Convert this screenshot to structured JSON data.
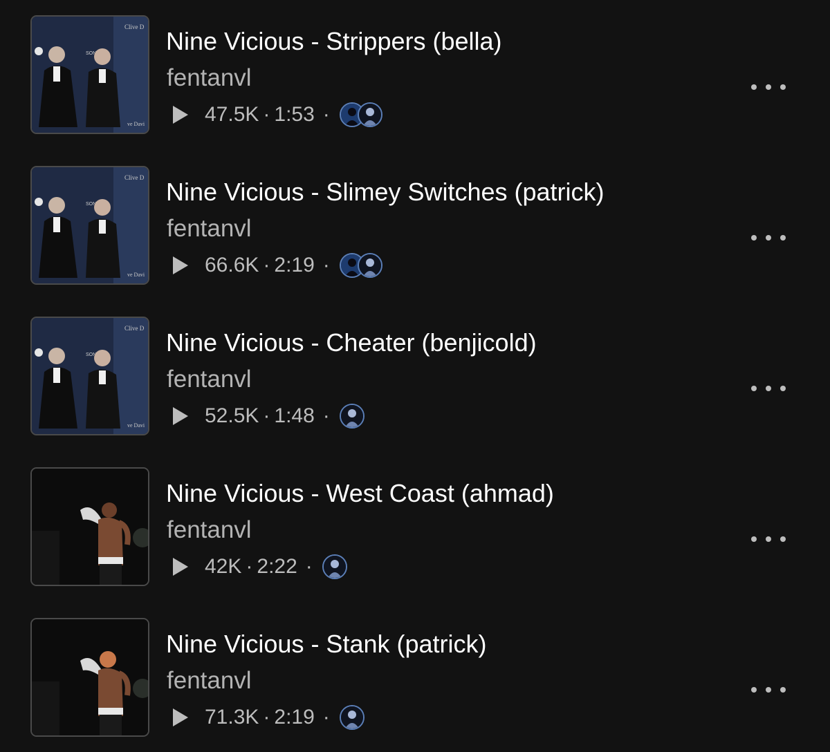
{
  "tracks": [
    {
      "title": "Nine Vicious - Strippers (bella)",
      "artist": "fentanvl",
      "plays": "47.5K",
      "duration": "1:53",
      "separator": "·",
      "artwork": "suits-photo",
      "avatars": [
        "avatar-blue",
        "avatar-dark"
      ]
    },
    {
      "title": "Nine Vicious - Slimey Switches (patrick)",
      "artist": "fentanvl",
      "plays": "66.6K",
      "duration": "2:19",
      "separator": "·",
      "artwork": "suits-photo",
      "avatars": [
        "avatar-blue",
        "avatar-dark"
      ]
    },
    {
      "title": "Nine Vicious - Cheater (benjicold)",
      "artist": "fentanvl",
      "plays": "52.5K",
      "duration": "1:48",
      "separator": "·",
      "artwork": "suits-photo",
      "avatars": [
        "avatar-dark"
      ]
    },
    {
      "title": "Nine Vicious - West Coast (ahmad)",
      "artist": "fentanvl",
      "plays": "42K",
      "duration": "2:22",
      "separator": "·",
      "artwork": "performer-photo",
      "avatars": [
        "avatar-dark"
      ]
    },
    {
      "title": "Nine Vicious - Stank (patrick)",
      "artist": "fentanvl",
      "plays": "71.3K",
      "duration": "2:19",
      "separator": "·",
      "artwork": "performer-photo",
      "avatars": [
        "avatar-dark"
      ]
    }
  ],
  "icons": {
    "play": "play-icon",
    "more": "more-options-icon"
  },
  "colors": {
    "background": "#121212",
    "title": "#ffffff",
    "secondary": "#b3b3b3"
  }
}
